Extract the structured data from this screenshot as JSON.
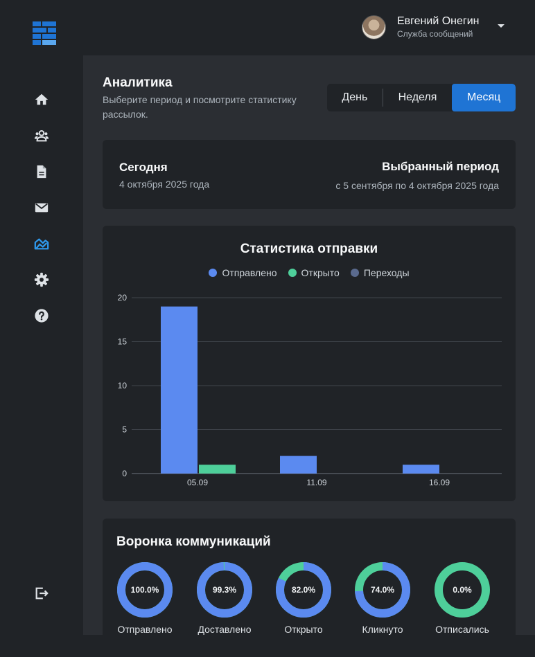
{
  "user": {
    "name": "Евгений Онегин",
    "role": "Служба сообщений"
  },
  "sidebar": {
    "items": [
      {
        "icon": "home-icon"
      },
      {
        "icon": "users-icon"
      },
      {
        "icon": "document-icon"
      },
      {
        "icon": "mail-icon"
      },
      {
        "icon": "analytics-icon",
        "active": true
      },
      {
        "icon": "gear-icon"
      },
      {
        "icon": "help-icon"
      }
    ],
    "logout_icon": "logout-icon"
  },
  "colors": {
    "accent": "#1f74d4",
    "sent": "#5b8af0",
    "opened": "#4ecf9a",
    "clicks": "#5a6a8e",
    "active_icon": "#2f9bf0"
  },
  "header": {
    "title": "Аналитика",
    "subtitle": "Выберите период и посмотрите статистику рассылок.",
    "periods": [
      "День",
      "Неделя",
      "Месяц"
    ],
    "selected_period": "Месяц"
  },
  "period_card": {
    "today_label": "Сегодня",
    "today_date": "4 октября 2025 года",
    "period_label": "Выбранный период",
    "period_range": "с 5 сентября по 4 октября 2025 года"
  },
  "chart_data": {
    "type": "bar",
    "title": "Статистика отправки",
    "categories": [
      "05.09",
      "11.09",
      "16.09"
    ],
    "series": [
      {
        "name": "Отправлено",
        "values": [
          19,
          2,
          1
        ],
        "color": "#5b8af0"
      },
      {
        "name": "Открыто",
        "values": [
          1,
          0,
          0
        ],
        "color": "#4ecf9a"
      },
      {
        "name": "Переходы",
        "values": [
          0,
          0,
          0
        ],
        "color": "#5a6a8e"
      }
    ],
    "ylim": [
      0,
      20
    ],
    "yticks": [
      0,
      5,
      10,
      15,
      20
    ],
    "grid": true,
    "legend": "top-center",
    "xlabel": "",
    "ylabel": ""
  },
  "funnel": {
    "title": "Воронка коммуникаций",
    "items": [
      {
        "label": "Отправлено",
        "percent_text": "100.0%",
        "fill": 1.0,
        "color": "#5b8af0",
        "rest_color": "#4ecf9a"
      },
      {
        "label": "Доставлено",
        "percent_text": "99.3%",
        "fill": 0.993,
        "color": "#5b8af0",
        "rest_color": "#4ecf9a"
      },
      {
        "label": "Открыто",
        "percent_text": "82.0%",
        "fill": 0.82,
        "color": "#5b8af0",
        "rest_color": "#4ecf9a"
      },
      {
        "label": "Кликнуто",
        "percent_text": "74.0%",
        "fill": 0.74,
        "color": "#5b8af0",
        "rest_color": "#4ecf9a"
      },
      {
        "label": "Отписались",
        "percent_text": "0.0%",
        "fill": 0.0,
        "color": "#5b8af0",
        "rest_color": "#4ecf9a"
      }
    ]
  }
}
